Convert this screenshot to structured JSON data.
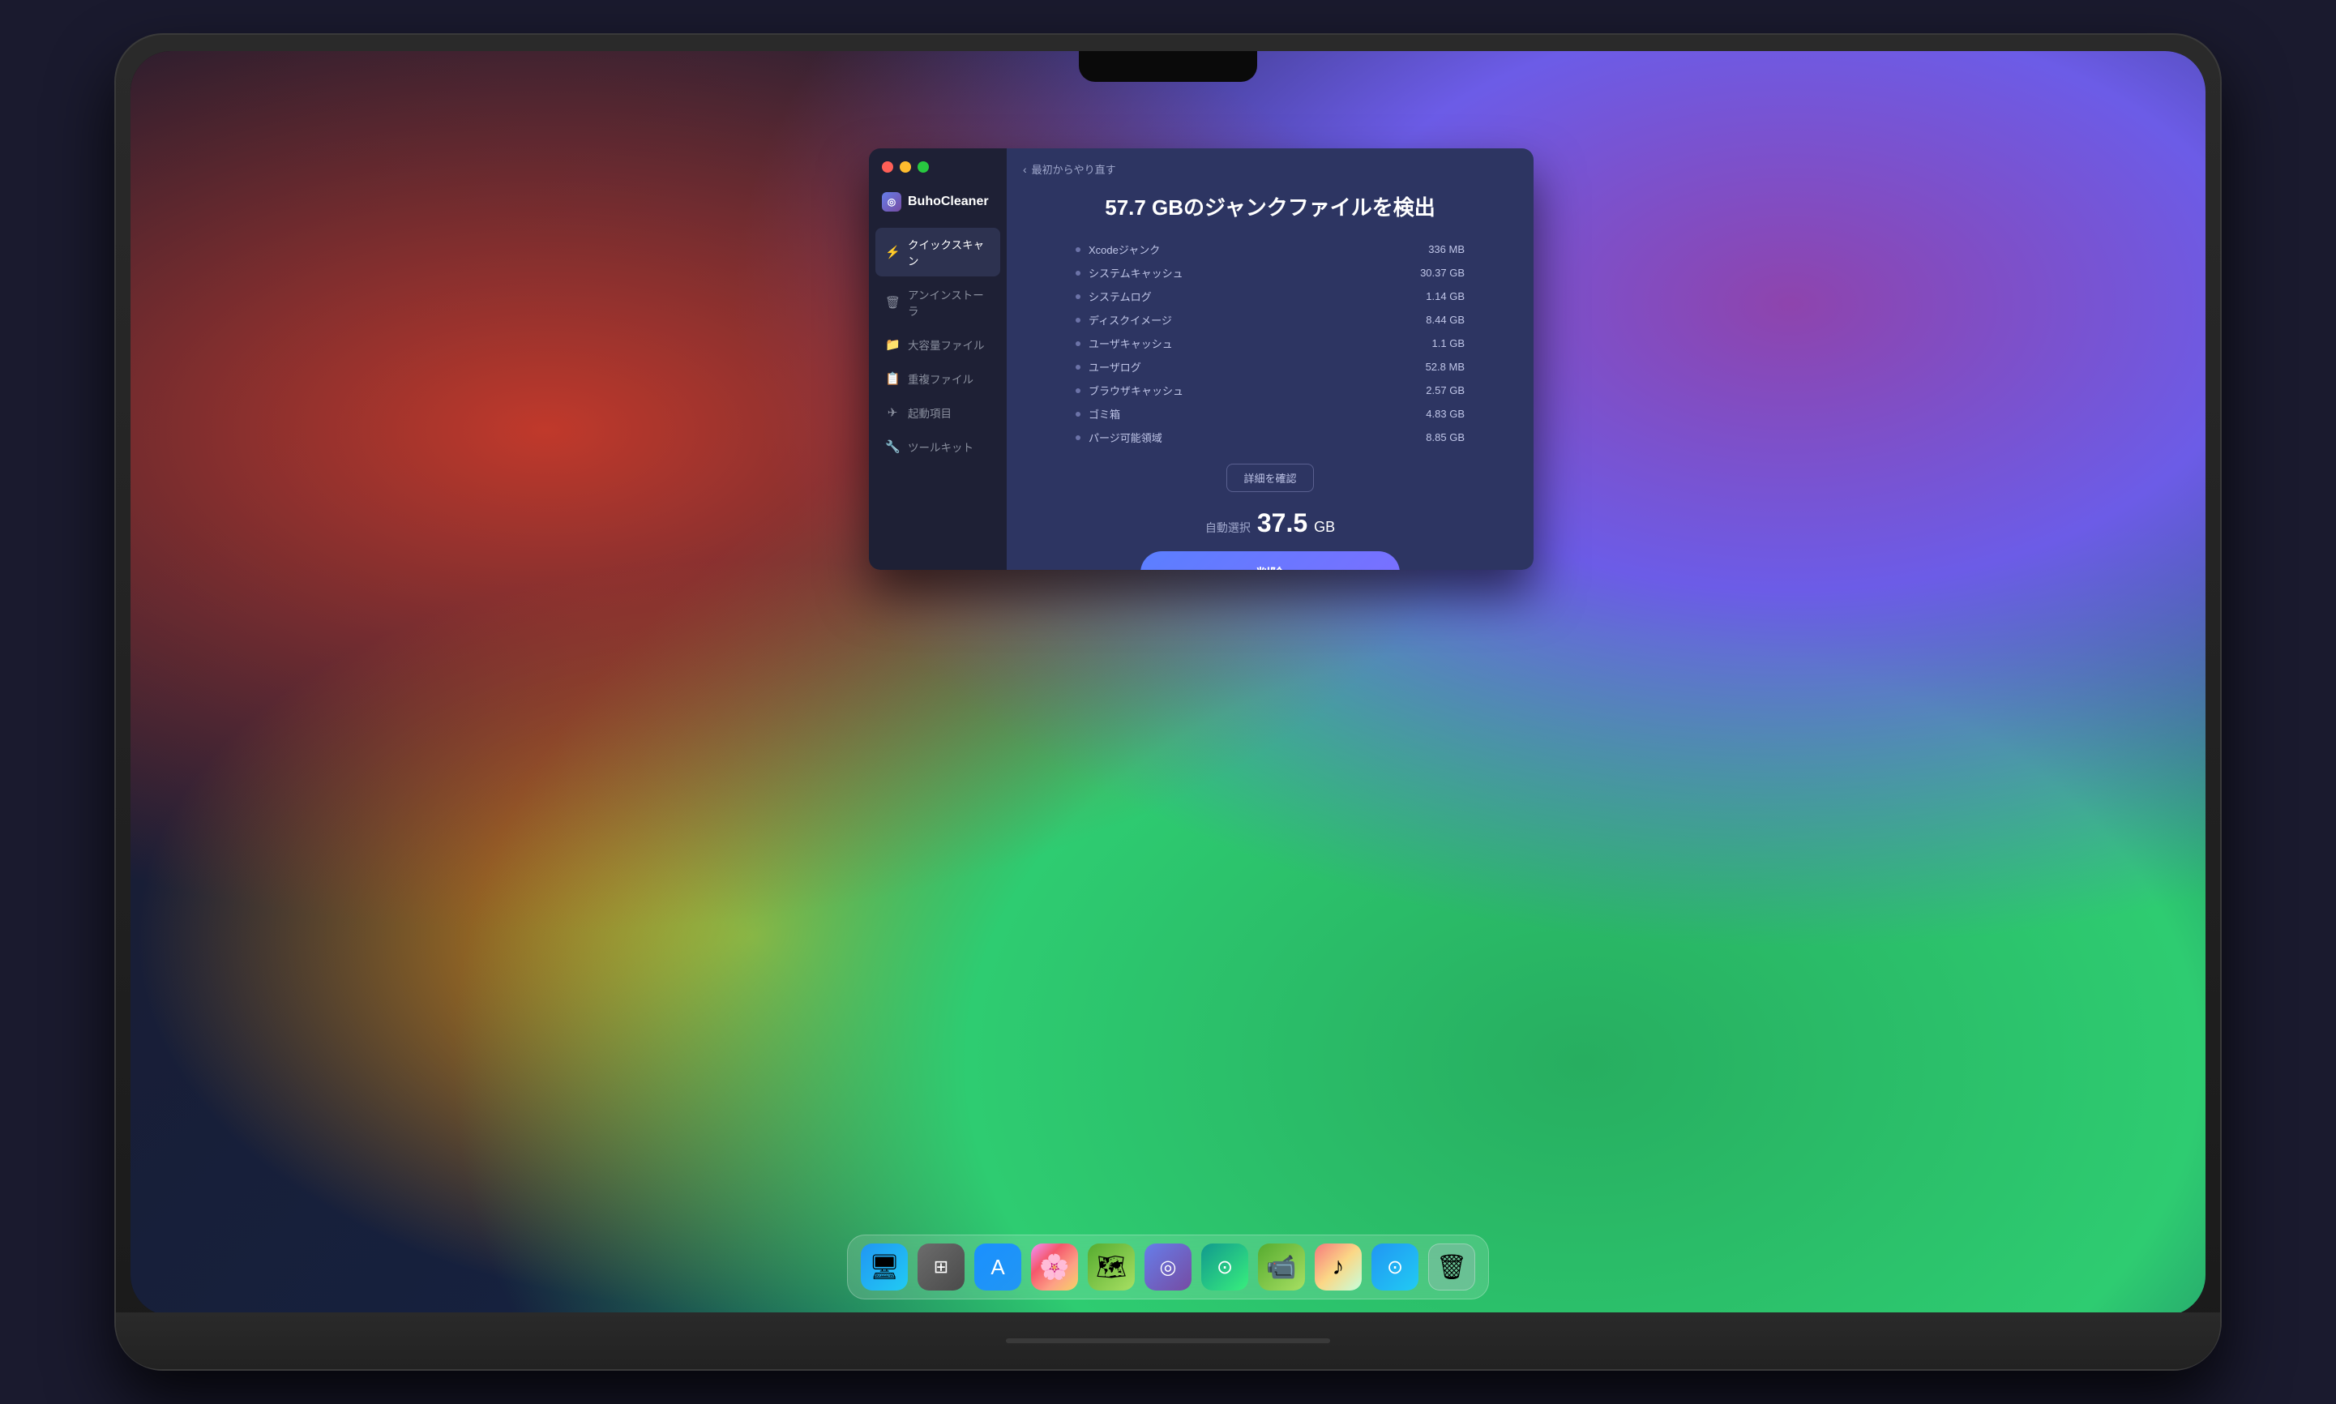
{
  "window": {
    "title": "BuhoCleaner",
    "controls": [
      "close",
      "minimize",
      "maximize"
    ]
  },
  "back_button": "最初からやり直す",
  "scan": {
    "title": "57.7 GBのジャンクファイルを検出",
    "items": [
      {
        "label": "Xcodeジャンク",
        "size": "336 MB"
      },
      {
        "label": "システムキャッシュ",
        "size": "30.37 GB"
      },
      {
        "label": "システムログ",
        "size": "1.14 GB"
      },
      {
        "label": "ディスクイメージ",
        "size": "8.44 GB"
      },
      {
        "label": "ユーザキャッシュ",
        "size": "1.1 GB"
      },
      {
        "label": "ユーザログ",
        "size": "52.8 MB"
      },
      {
        "label": "ブラウザキャッシュ",
        "size": "2.57 GB"
      },
      {
        "label": "ゴミ箱",
        "size": "4.83 GB"
      },
      {
        "label": "パージ可能領域",
        "size": "8.85 GB"
      }
    ],
    "details_button": "詳細を確認",
    "auto_select_label": "自動選択",
    "auto_select_size": "37.5",
    "auto_select_unit": "GB",
    "delete_button": "削除"
  },
  "sidebar": {
    "items": [
      {
        "label": "クイックスキャン",
        "icon": "⚡",
        "active": true
      },
      {
        "label": "アンインストーラ",
        "icon": "🗑"
      },
      {
        "label": "大容量ファイル",
        "icon": "📁"
      },
      {
        "label": "重複ファイル",
        "icon": "📋"
      },
      {
        "label": "起動項目",
        "icon": "🚀"
      },
      {
        "label": "ツールキット",
        "icon": "🔧"
      }
    ]
  },
  "dock": {
    "items": [
      {
        "name": "Finder",
        "emoji": "😊",
        "style": "dock-finder"
      },
      {
        "name": "Launchpad",
        "emoji": "🚀",
        "style": "dock-launchpad"
      },
      {
        "name": "App Store",
        "emoji": "A",
        "style": "dock-appstore"
      },
      {
        "name": "Photos",
        "emoji": "🌸",
        "style": "dock-photos"
      },
      {
        "name": "Maps",
        "emoji": "🗺",
        "style": "dock-maps"
      },
      {
        "name": "BuhoCleaner",
        "emoji": "◎",
        "style": "dock-buho"
      },
      {
        "name": "TouchRetouch",
        "emoji": "⊙",
        "style": "dock-touchretouch"
      },
      {
        "name": "FaceTime",
        "emoji": "📹",
        "style": "dock-facetime"
      },
      {
        "name": "Music",
        "emoji": "♪",
        "style": "dock-music"
      },
      {
        "name": "Safari",
        "emoji": "⊙",
        "style": "dock-safari"
      },
      {
        "name": "Trash",
        "emoji": "🗑",
        "style": "dock-trash"
      }
    ]
  }
}
